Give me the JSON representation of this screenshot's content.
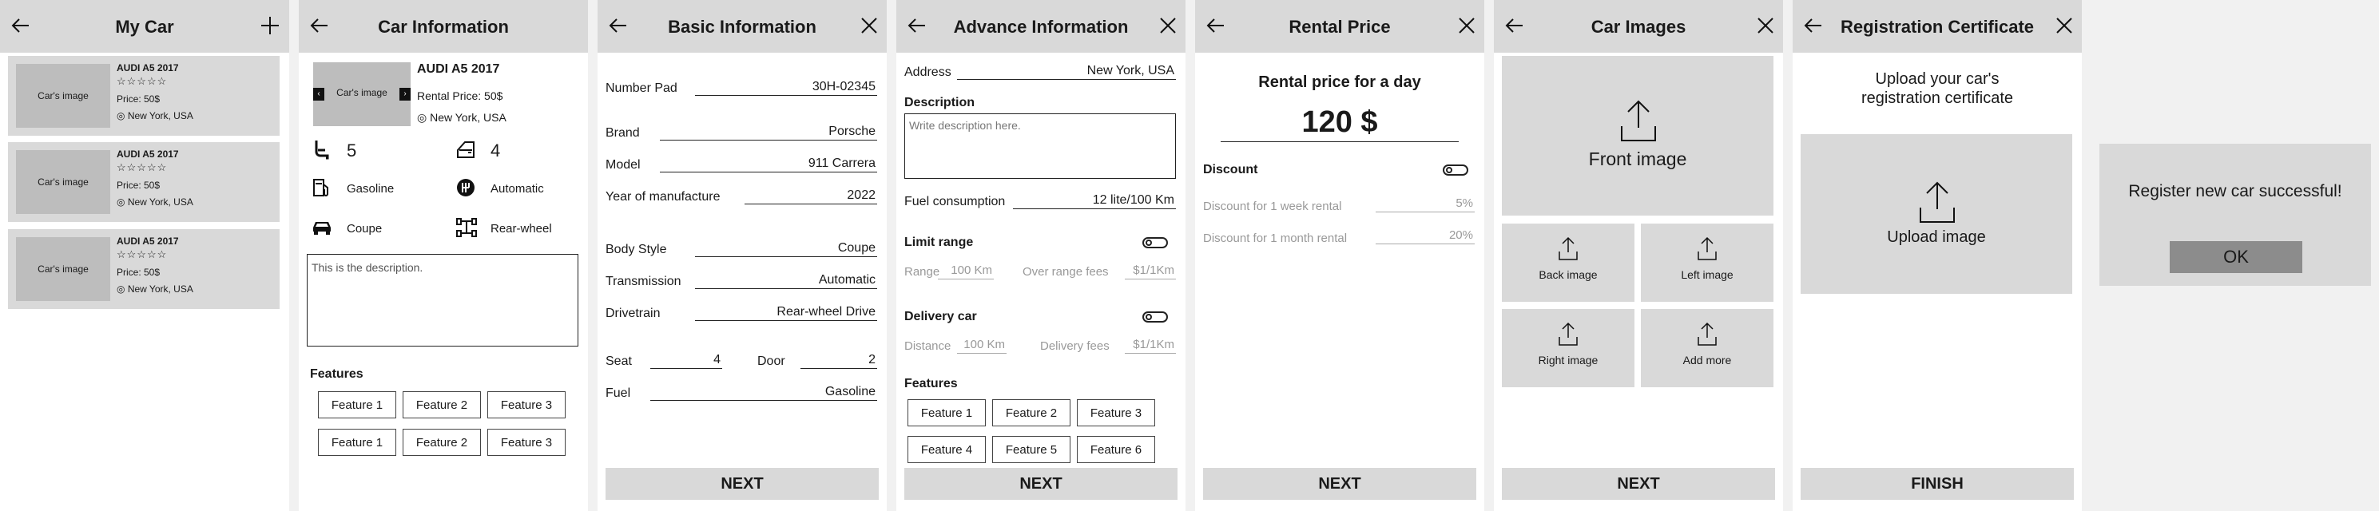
{
  "screen1": {
    "title": "My Car",
    "cards": [
      {
        "image": "Car's image",
        "name": "AUDI A5 2017",
        "stars": "☆☆☆☆☆",
        "price": "Price: 50$",
        "location": "New York, USA"
      },
      {
        "image": "Car's image",
        "name": "AUDI A5 2017",
        "stars": "☆☆☆☆☆",
        "price": "Price: 50$",
        "location": "New York, USA"
      },
      {
        "image": "Car's image",
        "name": "AUDI A5 2017",
        "stars": "☆☆☆☆☆",
        "price": "Price: 50$",
        "location": "New York, USA"
      }
    ]
  },
  "screen2": {
    "title": "Car Information",
    "image": "Car's image",
    "name": "AUDI A5 2017",
    "price": "Rental Price: 50$",
    "location": "New York, USA",
    "seats": "5",
    "doors": "4",
    "fuel": "Gasoline",
    "transmission": "Automatic",
    "body": "Coupe",
    "drivetrain": "Rear-wheel",
    "description": "This is the description.",
    "features_title": "Features",
    "features": [
      "Feature 1",
      "Feature 2",
      "Feature 3",
      "Feature 1",
      "Feature 2",
      "Feature 3"
    ]
  },
  "screen3": {
    "title": "Basic Information",
    "number_pad_label": "Number Pad",
    "number_pad": "30H-02345",
    "brand_label": "Brand",
    "brand": "Porsche",
    "model_label": "Model",
    "model": "911 Carrera",
    "year_label": "Year of manufacture",
    "year": "2022",
    "body_label": "Body Style",
    "body": "Coupe",
    "transmission_label": "Transmission",
    "transmission": "Automatic",
    "drivetrain_label": "Drivetrain",
    "drivetrain": "Rear-wheel Drive",
    "seat_label": "Seat",
    "seat": "4",
    "door_label": "Door",
    "door": "2",
    "fuel_label": "Fuel",
    "fuel": "Gasoline",
    "next": "NEXT"
  },
  "screen4": {
    "title": "Advance Information",
    "address_label": "Address",
    "address": "New York, USA",
    "description_label": "Description",
    "description_placeholder": "Write description here.",
    "consumption_label": "Fuel consumption",
    "consumption": "12 lite/100 Km",
    "limit_label": "Limit range",
    "range_label": "Range",
    "range": "100 Km",
    "over_label": "Over range fees",
    "over": "$1/1Km",
    "delivery_label": "Delivery car",
    "distance_label": "Distance",
    "distance": "100 Km",
    "delivery_fee_label": "Delivery fees",
    "delivery_fee": "$1/1Km",
    "features_title": "Features",
    "features": [
      "Feature 1",
      "Feature 2",
      "Feature 3",
      "Feature 4",
      "Feature 5",
      "Feature 6"
    ],
    "next": "NEXT"
  },
  "screen5": {
    "title": "Rental Price",
    "subtitle": "Rental price for a day",
    "price": "120 $",
    "discount_label": "Discount",
    "week_label": "Discount for 1 week rental",
    "week": "5%",
    "month_label": "Discount for 1 month rental",
    "month": "20%",
    "next": "NEXT"
  },
  "screen6": {
    "title": "Car Images",
    "front": "Front image",
    "back": "Back image",
    "left": "Left image",
    "right": "Right image",
    "more": "Add more",
    "next": "NEXT"
  },
  "screen7": {
    "title": "Registration Certificate",
    "line1": "Upload your car's",
    "line2": "registration certificate",
    "upload": "Upload image",
    "finish": "FINISH"
  },
  "screen8": {
    "message": "Register new car successful!",
    "ok": "OK"
  }
}
